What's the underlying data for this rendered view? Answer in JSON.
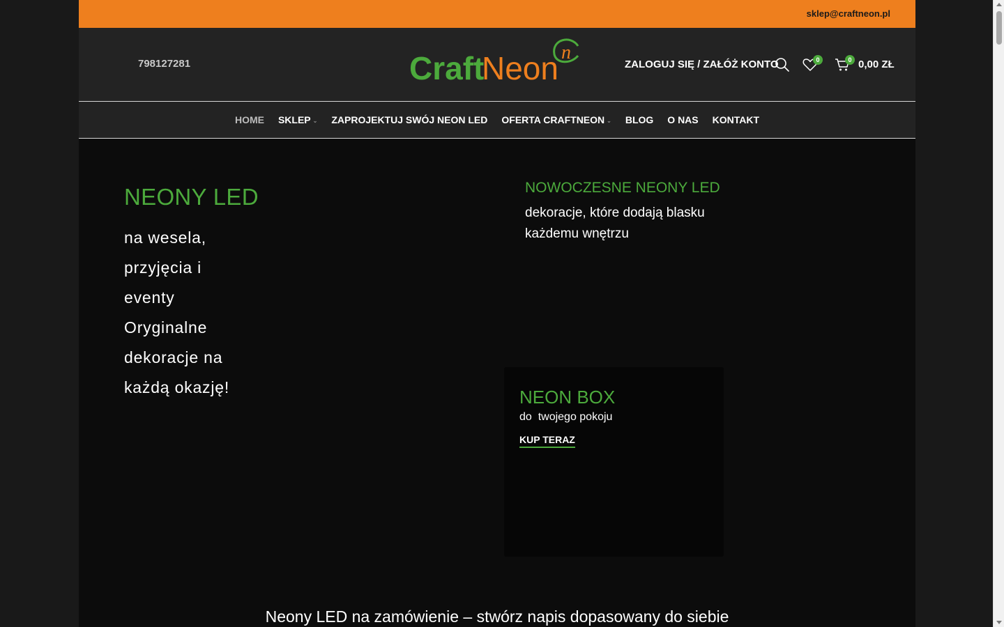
{
  "topbar": {
    "email": "sklep@craftneon.pl"
  },
  "header": {
    "phone": "798127281",
    "logo_text_craft": "Craft",
    "logo_text_neon": "Neon",
    "logo_mark": "n",
    "login_label": "ZALOGUJ SIĘ / ZAŁÓŻ KONTO",
    "wishlist_count": "0",
    "cart_count": "0",
    "cart_total": "0,00 ZŁ",
    "icons": [
      "search-icon",
      "heart-icon",
      "cart-icon"
    ]
  },
  "nav": {
    "items": [
      {
        "label": "HOME",
        "active": true,
        "has_dropdown": false
      },
      {
        "label": "SKLEP",
        "active": false,
        "has_dropdown": true
      },
      {
        "label": "ZAPROJEKTUJ SWÓJ NEON LED",
        "active": false,
        "has_dropdown": false
      },
      {
        "label": "OFERTA CRAFTNEON",
        "active": false,
        "has_dropdown": true
      },
      {
        "label": "BLOG",
        "active": false,
        "has_dropdown": false
      },
      {
        "label": "O NAS",
        "active": false,
        "has_dropdown": false
      },
      {
        "label": "KONTAKT",
        "active": false,
        "has_dropdown": false
      }
    ],
    "dropdown_glyph": "⌄"
  },
  "hero": {
    "title": "NEONY LED",
    "lines": [
      "na wesela,",
      "przyjęcia i",
      "eventy",
      "Oryginalne",
      "dekoracje na",
      "każdą okazję!"
    ]
  },
  "modern": {
    "title": "NOWOCZESNE NEONY LED",
    "subtitle": "dekoracje, które dodają blasku każdemu wnętrzu"
  },
  "neon_box": {
    "title": "NEON BOX",
    "subtitle": "do  twojego pokoju",
    "cta": "KUP TERAZ"
  },
  "bottom": {
    "heading": "Neony LED na zamówienie – stwórz napis dopasowany do siebie"
  },
  "colors": {
    "accent_orange": "#ee7f1e",
    "accent_green": "#4caa3c",
    "header_bg": "#232323",
    "page_bg": "#0c0c0c"
  }
}
